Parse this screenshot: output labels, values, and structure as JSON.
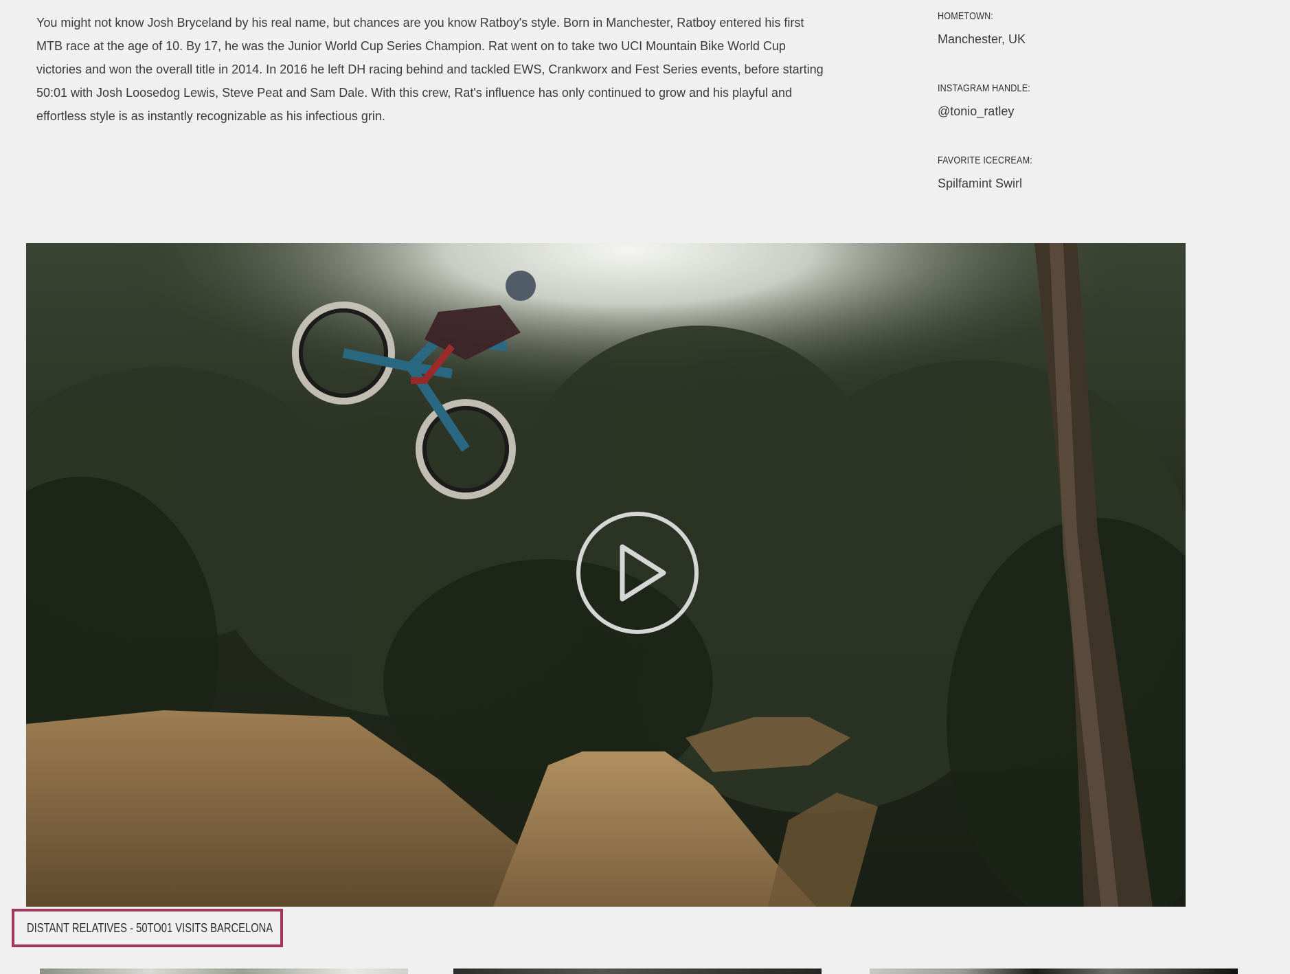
{
  "bio": {
    "text": "You might not know Josh Bryceland by his real name, but chances are you know Ratboy's style. Born in Manchester, Ratboy entered his first MTB race at the age of 10. By 17, he was the Junior World Cup Series Champion. Rat went on to take two UCI Mountain Bike World Cup victories and won the overall title in 2014. In 2016 he left DH racing behind and tackled EWS, Crankworx and Fest Series events, before starting 50:01 with Josh Loosedog Lewis, Steve Peat and Sam Dale. With this crew, Rat's influence has only continued to grow and his playful and effortless style is as instantly recognizable as his infectious grin."
  },
  "facts": {
    "hometown_label": "HOMETOWN:",
    "hometown_value": "Manchester, UK",
    "instagram_label": "INSTAGRAM HANDLE:",
    "instagram_value": "@tonio_ratley",
    "icecream_label": "FAVORITE ICECREAM:",
    "icecream_value": "Spilfamint Swirl"
  },
  "video": {
    "play_icon": "play-circle-icon",
    "caption": "DISTANT RELATIVES - 50TO01 VISITS BARCELONA"
  },
  "colors": {
    "background": "#f0f0f0",
    "caption_border": "#a3365f",
    "text": "#3a3a3a"
  }
}
